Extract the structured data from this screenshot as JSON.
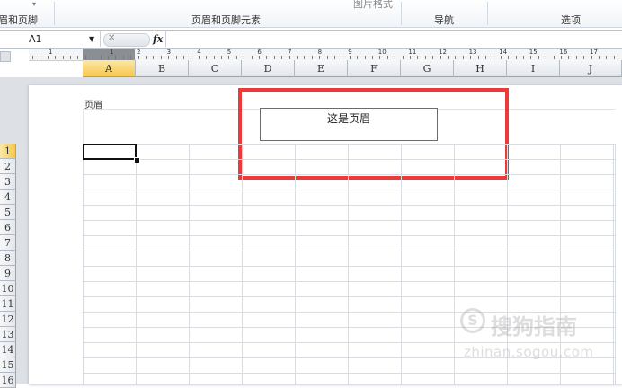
{
  "ribbon": {
    "top_fragment": "▾",
    "picture_format": "图片格式",
    "groups": [
      {
        "label": "眉和页脚"
      },
      {
        "label": "页眉和页脚元素"
      },
      {
        "label": "导航"
      },
      {
        "label": "选项"
      }
    ]
  },
  "formula_bar": {
    "name_box": "A1",
    "name_dropdown": "▼",
    "cancel_glyph": "✕",
    "fx_label": "fx",
    "formula_value": ""
  },
  "ruler": {
    "numbers": [
      "1",
      "1",
      "2",
      "3",
      "4",
      "5",
      "6",
      "7",
      "8",
      "9",
      "10",
      "11",
      "12",
      "13",
      "14",
      "15",
      "16",
      "17"
    ]
  },
  "columns": [
    "A",
    "B",
    "C",
    "D",
    "E",
    "F",
    "G",
    "H",
    "I",
    "J"
  ],
  "rows": [
    "1",
    "2",
    "3",
    "4",
    "5",
    "6",
    "7",
    "8",
    "9",
    "10",
    "11",
    "12",
    "13",
    "14",
    "15",
    "16"
  ],
  "page": {
    "header_label": "页眉",
    "header_center_text": "这是页眉",
    "highlight_color": "#ea3b3b"
  },
  "watermark": {
    "logo_letter": "S",
    "brand": "搜狗指南",
    "url": "zhinan.sogou.com"
  },
  "colors": {
    "active_header": "#f6c74e",
    "grid_line": "#d9dde2"
  }
}
